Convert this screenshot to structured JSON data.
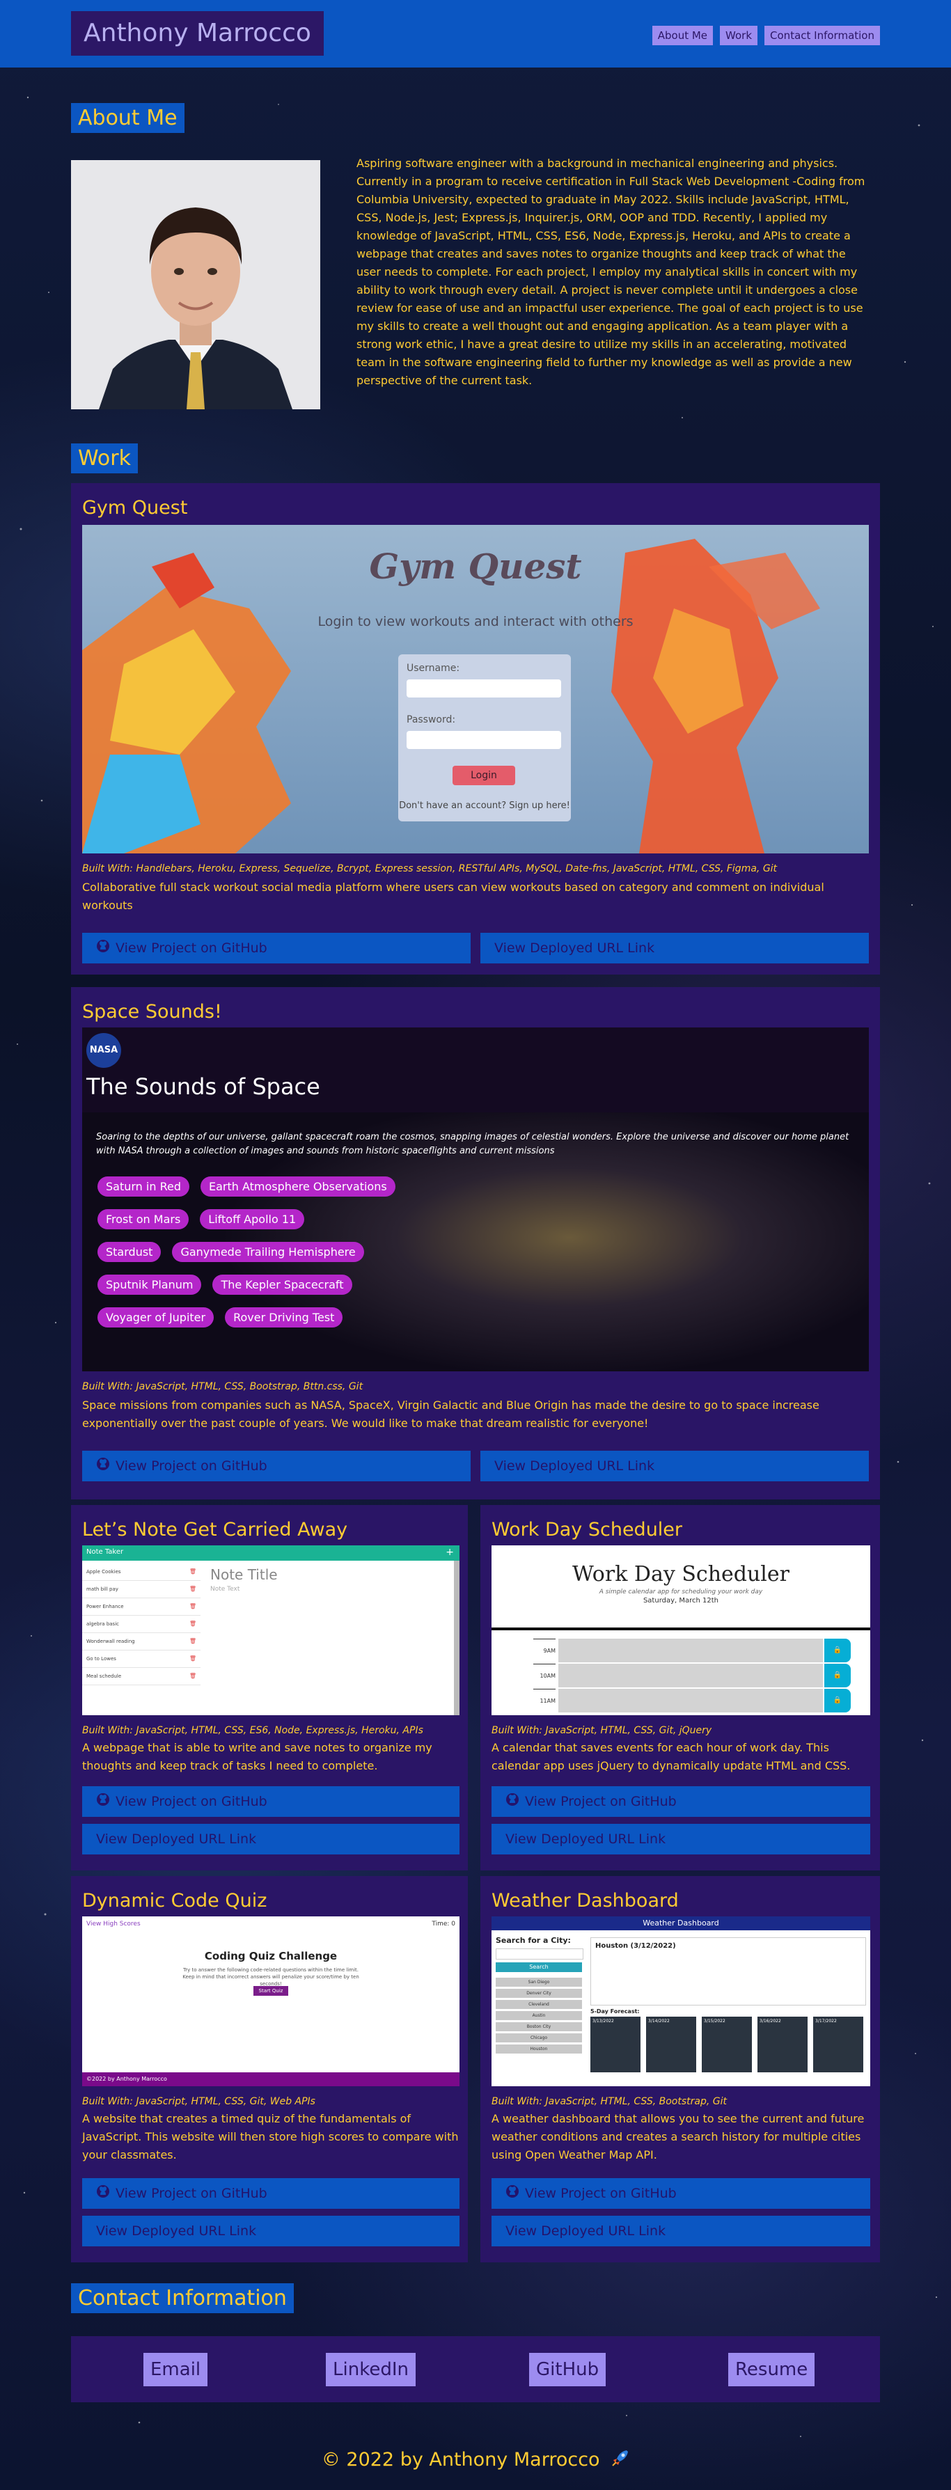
{
  "header": {
    "brand": "Anthony Marrocco",
    "nav": [
      "About Me",
      "Work",
      "Contact Information"
    ]
  },
  "about": {
    "title": "About Me",
    "text": "Aspiring software engineer with a background in mechanical engineering and physics. Currently in a program to receive certification in Full Stack Web Development -Coding from Columbia University, expected to graduate in May 2022. Skills include JavaScript, HTML, CSS, Node.js, Jest; Express.js, Inquirer.js, ORM, OOP and TDD. Recently, I applied my knowledge of JavaScript, HTML, CSS, ES6, Node, Express.js, Heroku, and APIs to create a webpage that creates and saves notes to organize thoughts and keep track of what the user needs to complete. For each project, I employ my analytical skills in concert with my ability to work through every detail. A project is never complete until it undergoes a close review for ease of use and an impactful user experience. The goal of each project is to use my skills to create a well thought out and engaging application. As a team player with a strong work ethic, I have a great desire to utilize my skills in an accelerating, motivated team in the software engineering field to further my knowledge as well as provide a new perspective of the current task."
  },
  "work": {
    "title": "Work",
    "github_label": "View Project on GitHub",
    "deployed_label": "View Deployed URL Link",
    "projects": [
      {
        "name": "Gym Quest",
        "built": "Built With: Handlebars, Heroku, Express, Sequelize, Bcrypt, Express session, RESTful APIs, MySQL, Date-fns, JavaScript, HTML, CSS, Figma, Git",
        "desc": "Collaborative full stack workout social media platform where users can view workouts based on category and comment on individual workouts",
        "shot": {
          "title": "Gym Quest",
          "subtitle": "Login to view workouts and interact with others",
          "username": "Username:",
          "password": "Password:",
          "login": "Login",
          "signup": "Don't have an account? Sign up here!"
        }
      },
      {
        "name": "Space Sounds!",
        "built": "Built With: JavaScript, HTML, CSS, Bootstrap, Bttn.css, Git",
        "desc": "Space missions from companies such as NASA, SpaceX, Virgin Galactic and Blue Origin has made the desire to go to space increase exponentially over the past couple of years. We would like to make that dream realistic for everyone!",
        "shot": {
          "logo": "NASA",
          "title": "The Sounds of Space",
          "intro": "Soaring to the depths of our universe, gallant spacecraft roam the cosmos, snapping images of celestial wonders. Explore the universe and discover our home planet with NASA through a collection of images and sounds from historic spaceflights and current missions",
          "pills": [
            [
              "Saturn in Red",
              "Earth Atmosphere Observations"
            ],
            [
              "Frost on Mars",
              "Liftoff Apollo 11"
            ],
            [
              "Stardust",
              "Ganymede Trailing Hemisphere"
            ],
            [
              "Sputnik Planum",
              "The Kepler Spacecraft"
            ],
            [
              "Voyager of Jupiter",
              "Rover Driving Test"
            ]
          ]
        }
      },
      {
        "name": "Let’s Note Get Carried Away",
        "built": "Built With: JavaScript, HTML, CSS, ES6, Node, Express.js, Heroku, APIs",
        "desc": "A webpage that is able to write and save notes to organize my thoughts and keep track of tasks I need to complete.",
        "shot": {
          "bar": "Note Taker",
          "note_title": "Note Title",
          "note_text": "Note Text",
          "items": [
            "Apple Cookies",
            "math bill pay",
            "Power Enhance",
            "algebra basic",
            "Wonderwall reading",
            "Go to Lowes",
            "Meal schedule"
          ]
        }
      },
      {
        "name": "Work Day Scheduler",
        "built": "Built With: JavaScript, HTML, CSS, Git, jQuery",
        "desc": "A calendar that saves events for each hour of work day. This calendar app uses jQuery to dynamically update HTML and CSS.",
        "shot": {
          "title": "Work Day Scheduler",
          "subtitle": "A simple calendar app for scheduling your work day",
          "date": "Saturday, March 12th",
          "hours": [
            "9AM",
            "10AM",
            "11AM"
          ]
        }
      },
      {
        "name": "Dynamic Code Quiz",
        "built": "Built With: JavaScript, HTML, CSS, Git, Web APIs",
        "desc": "A website that creates a timed quiz of the fundamentals of JavaScript. This website will then store high scores to compare with your classmates.",
        "shot": {
          "link": "View High Scores",
          "timer": "Time: 0",
          "title": "Coding Quiz Challenge",
          "text": "Try to answer the following code-related questions within the time limit. Keep in mind that incorrect answers will penalize your score/time by ten seconds!",
          "start": "Start Quiz",
          "footer": "©2022 by Anthony Marrocco"
        }
      },
      {
        "name": "Weather Dashboard",
        "built": "Built With: JavaScript, HTML, CSS, Bootstrap, Git",
        "desc": "A weather dashboard that allows you to see the current and future weather conditions and creates a search history for multiple cities using Open Weather Map API.",
        "shot": {
          "title": "Weather Dashboard",
          "search_label": "Search for a City:",
          "search_btn": "Search",
          "cities": [
            "San Diego",
            "Denver City",
            "Cleveland",
            "Austin",
            "Boston City",
            "Chicago",
            "Houston"
          ],
          "current": "Houston (3/12/2022)",
          "forecast_label": "5-Day Forecast:",
          "forecast": [
            "3/13/2022",
            "3/14/2022",
            "3/15/2022",
            "3/16/2022",
            "3/17/2022"
          ]
        }
      }
    ]
  },
  "contact": {
    "title": "Contact Information",
    "links": [
      "Email",
      "LinkedIn",
      "GitHub",
      "Resume"
    ]
  },
  "footer": {
    "text": "© 2022 by Anthony Marrocco"
  },
  "colors": {
    "header": "#0b56c2",
    "card": "#2a1566",
    "accent": "#ffcc33",
    "nav_button": "#9d8cf0"
  }
}
